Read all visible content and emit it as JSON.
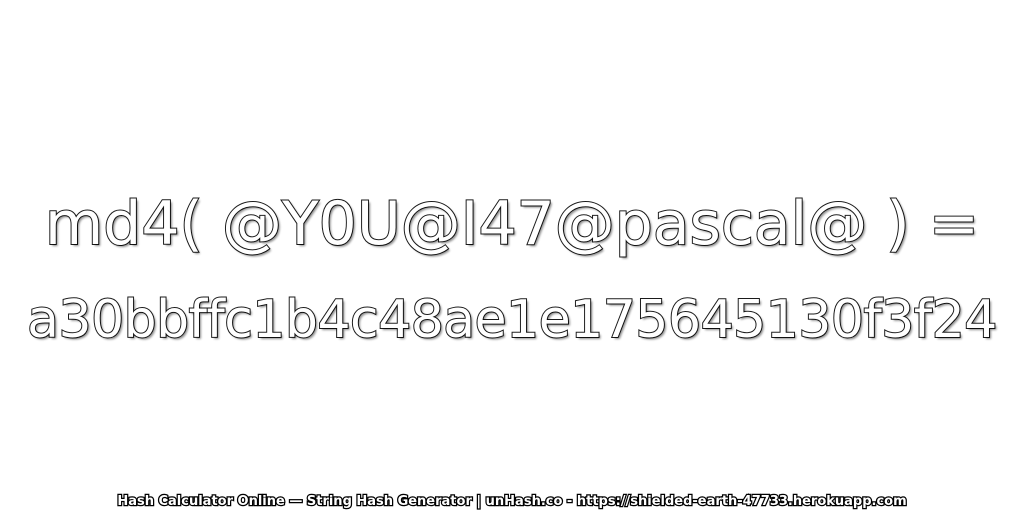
{
  "expression": "md4( @Y0U@I47@pascal@ ) =",
  "result": "a30bbffc1b4c48ae1e175645130f3f24",
  "footer": "Hash Calculator Online — String Hash Generator | unHash.co - https://shielded-earth-47733.herokuapp.com"
}
